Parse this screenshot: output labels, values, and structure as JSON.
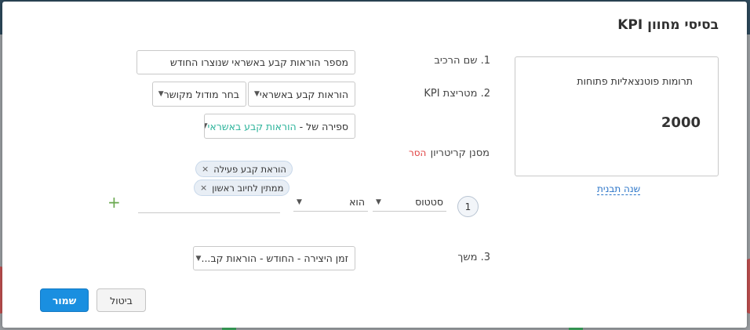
{
  "dialog": {
    "title": "בסיסי מחוון KPI"
  },
  "form": {
    "component_name": {
      "label": "1. שם הרכיב",
      "value": "מספר הוראות קבע באשראי שנוצרו החודש"
    },
    "kpi_metric": {
      "label": "2. מטריצת KPI",
      "metric_select": "הוראות קבע באשראי",
      "module_select": "בחר מודול מקושר",
      "count_prefix": "ספירה של - ",
      "count_target": "הוראות קבע באשראי"
    },
    "criteria": {
      "label": "מסנן קריטריון",
      "remove_label": "הסר",
      "chips": [
        "הוראת קבע פעילה",
        "ממתין לחיוב ראשון"
      ],
      "chip_remove_glyph": "×",
      "row_number": "1",
      "field_select": "סטטוס",
      "operator_select": "הוא",
      "value_input": "",
      "add_glyph": "+"
    },
    "duration": {
      "label": "3. משך",
      "select": "זמן היצירה - החודש - הוראות קב..."
    }
  },
  "preview": {
    "text": "תרומות פוטנצאליות פתוחות",
    "value": "2000",
    "change_template": "שנה תבנית"
  },
  "buttons": {
    "cancel": "ביטול",
    "save": "שמור"
  },
  "icons": {
    "caret": "▼"
  },
  "colors": {
    "accent": "#1a8fe0",
    "remove_red": "#e04040",
    "teal": "#2bb39a",
    "link_blue": "#2a74c8"
  }
}
